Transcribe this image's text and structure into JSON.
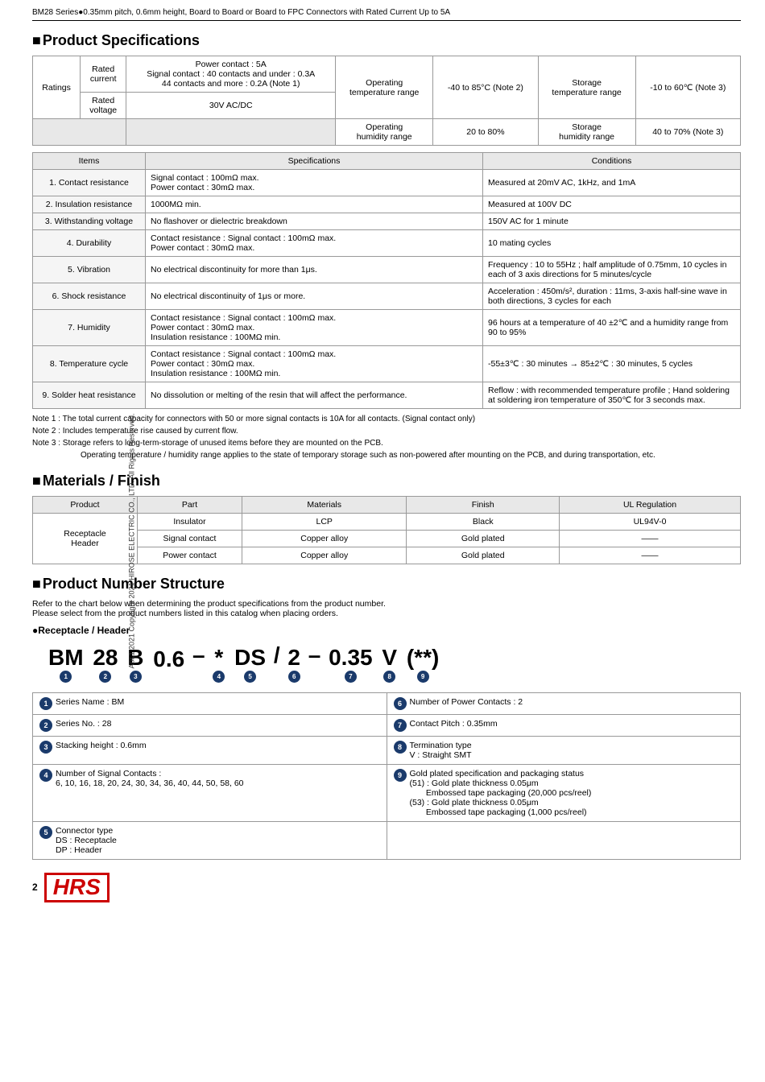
{
  "header": {
    "title": "BM28 Series●0.35mm pitch, 0.6mm height, Board to Board or Board to FPC Connectors with Rated Current Up to 5A"
  },
  "sidebar": {
    "text": "Apr.1.2021 Copyright 2021 HIROSE ELECTRIC CO., LTD. All Rights Reserved."
  },
  "product_specs": {
    "title": "Product Specifications",
    "ratings": {
      "headers": [
        "Ratings",
        "Rated current",
        "Power contact : 5A / Signal contact details",
        "Operating temperature range",
        "-40 to 85°C (Note 2)",
        "Storage temperature range",
        "-10 to 60℃ (Note 3)"
      ],
      "row1": {
        "label": "Rated current",
        "power": "Power contact : 5A",
        "signal": "Signal contact : 40 contacts and under : 0.3A",
        "signal2": "44 contacts and more  : 0.2A (Note 1)",
        "op_temp_label": "Operating temperature range",
        "op_temp_val": "-40 to 85°C (Note 2)",
        "stor_temp_label": "Storage temperature range",
        "stor_temp_val": "-10 to 60℃ (Note 3)"
      },
      "row2": {
        "label": "Rated voltage",
        "val": "30V AC/DC",
        "op_hum_label": "Operating humidity range",
        "op_hum_val": "20 to 80%",
        "stor_hum_label": "Storage humidity range",
        "stor_hum_val": "40 to 70% (Note 3)"
      }
    },
    "spec_headers": [
      "Items",
      "Specifications",
      "Conditions"
    ],
    "specs": [
      {
        "item": "1. Contact resistance",
        "spec": "Signal contact : 100mΩ max.\nPower contact : 30mΩ max.",
        "cond": "Measured at 20mV AC, 1kHz, and 1mA"
      },
      {
        "item": "2. Insulation resistance",
        "spec": "1000MΩ min.",
        "cond": "Measured at 100V DC"
      },
      {
        "item": "3. Withstanding voltage",
        "spec": "No flashover or dielectric breakdown",
        "cond": "150V AC for 1 minute"
      },
      {
        "item": "4. Durability",
        "spec": "Contact resistance : Signal contact : 100mΩ max.\nPower contact : 30mΩ max.",
        "cond": "10 mating cycles"
      },
      {
        "item": "5. Vibration",
        "spec": "No electrical discontinuity for more than 1μs.",
        "cond": "Frequency : 10 to 55Hz ; half amplitude of 0.75mm, 10 cycles in each of 3 axis directions for 5 minutes/cycle"
      },
      {
        "item": "6. Shock resistance",
        "spec": "No electrical discontinuity of 1μs or more.",
        "cond": "Acceleration : 450m/s², duration : 11ms, 3-axis half-sine wave in both directions, 3 cycles for each"
      },
      {
        "item": "7. Humidity",
        "spec": "Contact resistance : Signal contact : 100mΩ max.\nPower contact : 30mΩ max.\nInsulation resistance : 100MΩ min.",
        "cond": "96 hours at a temperature of 40 ±2℃ and a humidity range from 90 to 95%"
      },
      {
        "item": "8. Temperature cycle",
        "spec": "Contact resistance : Signal contact : 100mΩ max.\nPower contact : 30mΩ max.\nInsulation resistance : 100MΩ min.",
        "cond": "-55±3℃ : 30 minutes → 85±2℃ : 30 minutes, 5 cycles"
      },
      {
        "item": "9. Solder heat resistance",
        "spec": "No dissolution or melting of the resin that will affect the performance.",
        "cond": "Reflow : with recommended temperature profile ; Hand soldering at soldering iron temperature of 350℃ for 3 seconds max."
      }
    ],
    "notes": [
      "Note 1 : The total current capacity for connectors with 50 or more signal contacts is 10A for all contacts. (Signal contact only)",
      "Note 2 : Includes temperature rise caused by current flow.",
      "Note 3 : Storage refers to long-term-storage of unused items before they are mounted on the PCB.",
      "Operating temperature / humidity range applies to the state of temporary storage such as non-powered after mounting on the PCB, and during transportation, etc."
    ]
  },
  "materials_finish": {
    "title": "Materials / Finish",
    "headers": [
      "Product",
      "Part",
      "Materials",
      "Finish",
      "UL Regulation"
    ],
    "rows": [
      {
        "product": "Receptacle\nHeader",
        "part": "Insulator",
        "materials": "LCP",
        "finish": "Black",
        "ul": "UL94V-0"
      },
      {
        "product": "",
        "part": "Signal contact",
        "materials": "Copper alloy",
        "finish": "Gold plated",
        "ul": "——"
      },
      {
        "product": "",
        "part": "Power contact",
        "materials": "Copper alloy",
        "finish": "Gold plated",
        "ul": "——"
      }
    ]
  },
  "product_number": {
    "title": "Product Number Structure",
    "intro1": "Refer to the chart below when determining the product specifications from the product number.",
    "intro2": "Please select from the product numbers listed in this catalog when placing orders.",
    "receptacle_header": "●Receptacle / Header",
    "pn_display": "BM 28 B 0.6 – * DS / 2 – 0.35 V (**)",
    "segments": [
      {
        "text": "BM",
        "num": "1"
      },
      {
        "text": "28",
        "num": "2"
      },
      {
        "text": "B",
        "num": "3"
      },
      {
        "text": "0.6",
        "num": ""
      },
      {
        "text": "–",
        "num": ""
      },
      {
        "text": "*",
        "num": "4"
      },
      {
        "text": "DS",
        "num": "5"
      },
      {
        "text": "/",
        "num": ""
      },
      {
        "text": "2",
        "num": "6"
      },
      {
        "text": "–",
        "num": ""
      },
      {
        "text": "0.35",
        "num": "7"
      },
      {
        "text": "V",
        "num": "8"
      },
      {
        "text": "(**)",
        "num": "9"
      }
    ],
    "legend": [
      {
        "num": "1",
        "label": "Series Name : BM"
      },
      {
        "num": "6",
        "label": "Number of Power Contacts : 2"
      },
      {
        "num": "2",
        "label": "Series No. : 28"
      },
      {
        "num": "7",
        "label": "Contact Pitch : 0.35mm"
      },
      {
        "num": "3",
        "label": "Stacking height : 0.6mm"
      },
      {
        "num": "8",
        "label": "Termination type\nV : Straight SMT"
      },
      {
        "num": "4",
        "label": "Number of Signal Contacts :\n6, 10, 16, 18, 20, 24, 30, 34, 36, 40, 44, 50, 58, 60"
      },
      {
        "num": "9",
        "label": "Gold plated specification and packaging status\n(51) : Gold plate thickness 0.05μm\n       Embossed tape packaging (20,000 pcs/reel)\n(53) : Gold plate thickness 0.05μm\n       Embossed tape packaging (1,000 pcs/reel)"
      },
      {
        "num": "5",
        "label": "Connector type\nDS : Receptacle\nDP : Header"
      },
      {
        "num": "",
        "label": ""
      }
    ]
  },
  "footer": {
    "page_num": "2",
    "logo": "HRS"
  }
}
